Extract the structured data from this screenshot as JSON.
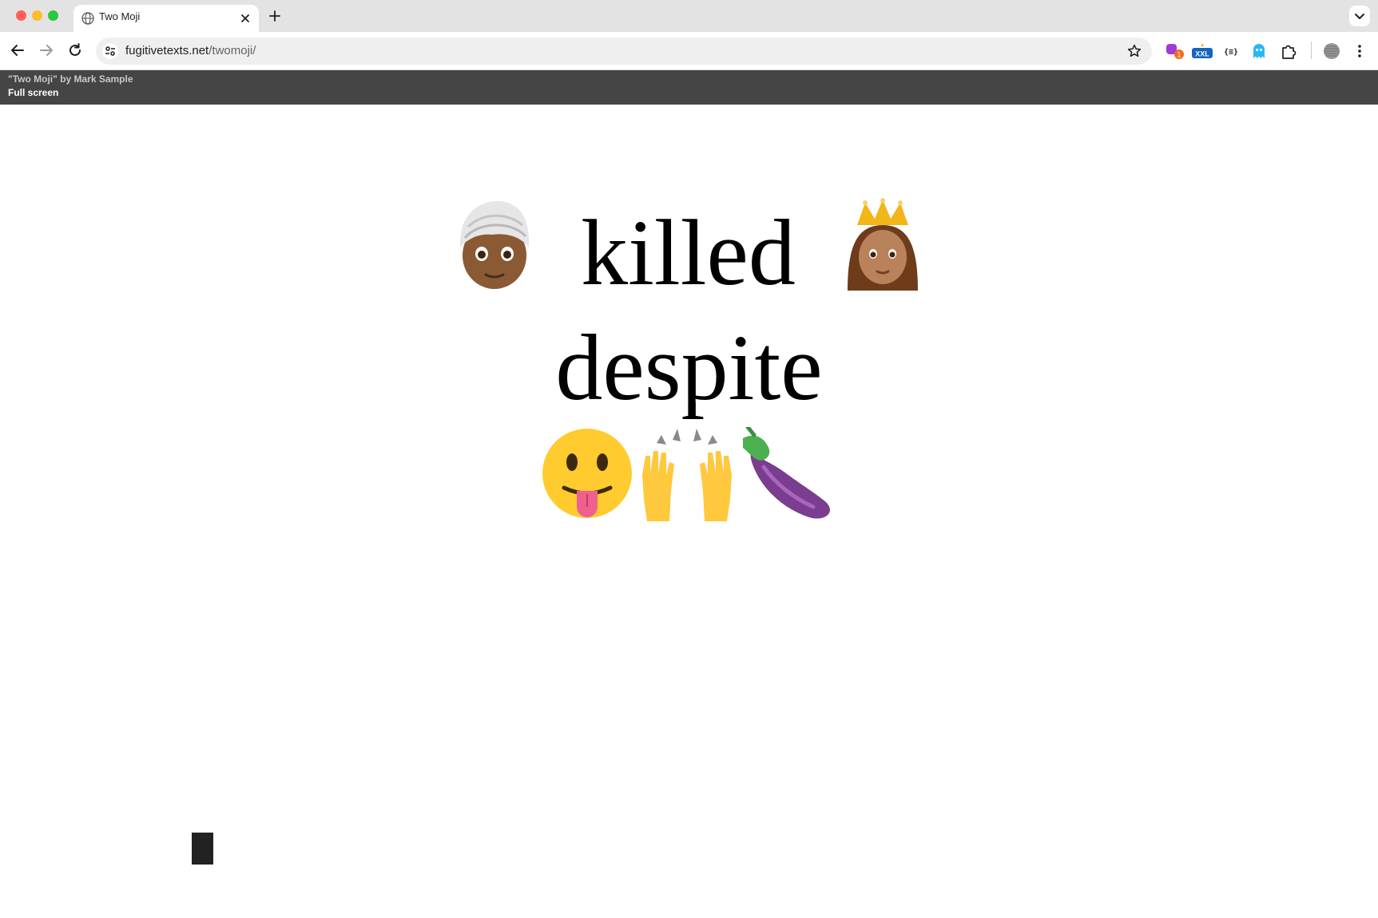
{
  "browser": {
    "tab_title": "Two Moji",
    "url_domain": "fugitivetexts.net",
    "url_path": "/twomoji/",
    "extensions": [
      "sticker-extension-icon",
      "xxl-extension-icon",
      "json-extension-icon",
      "ghost-extension-icon",
      "puzzle-extensions-icon"
    ],
    "badges": {
      "sticker": "1",
      "xxl": "XXL",
      "json": "{≡}"
    }
  },
  "page": {
    "credit": "\"Two Moji\" by Mark Sample",
    "fullscreen_link": "Full screen",
    "poem": {
      "line1_word": "killed",
      "line2_word": "despite"
    }
  },
  "icons": {
    "subject_emoji": "person-with-turban-emoji",
    "object_emoji": "princess-emoji",
    "row_emoji": [
      "face-with-tongue-emoji",
      "raising-hands-emoji",
      "eggplant-emoji"
    ]
  },
  "colors": {
    "header_bg": "#454545",
    "tabstrip_bg": "#e3e3e3",
    "omnibox_bg": "#efefef"
  }
}
